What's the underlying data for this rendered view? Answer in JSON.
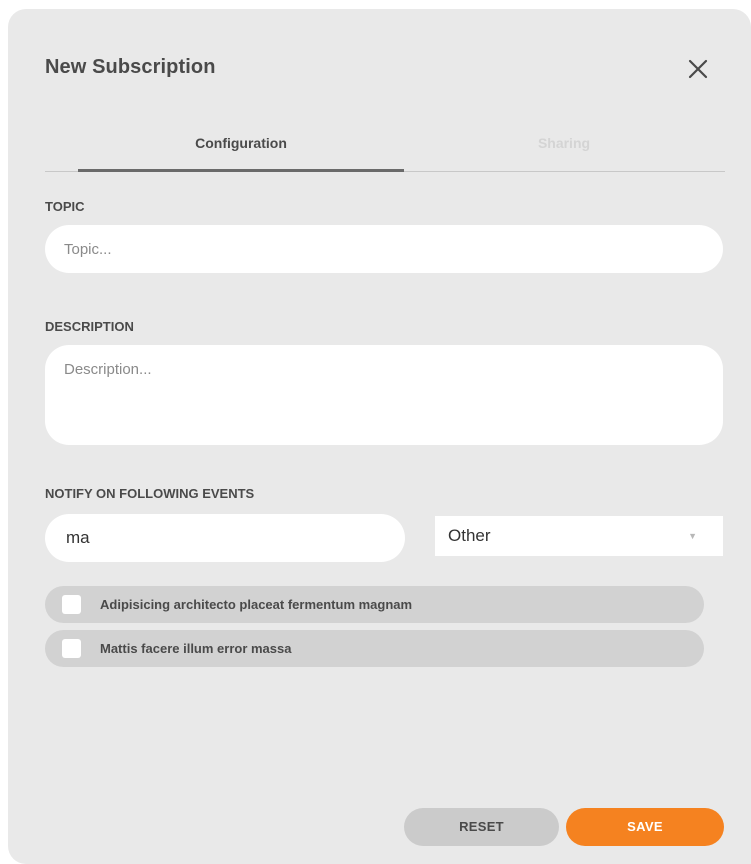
{
  "dialog": {
    "title": "New Subscription",
    "close_icon": "close-icon"
  },
  "tabs": [
    {
      "label": "Configuration",
      "active": true
    },
    {
      "label": "Sharing",
      "active": false
    }
  ],
  "form": {
    "topic": {
      "label": "TOPIC",
      "value": "",
      "placeholder": "Topic..."
    },
    "description": {
      "label": "DESCRIPTION",
      "value": "",
      "placeholder": "Description..."
    },
    "events": {
      "label": "NOTIFY ON FOLLOWING EVENTS",
      "search_value": "ma",
      "category_selected": "Other",
      "dropdown_icon": "caret-down-icon",
      "options": [
        {
          "label": "Adipisicing architecto placeat fermentum magnam",
          "checked": false
        },
        {
          "label": "Mattis facere illum error massa",
          "checked": false
        }
      ]
    }
  },
  "footer": {
    "reset_label": "RESET",
    "save_label": "SAVE"
  },
  "colors": {
    "accent": "#f58220",
    "modal_bg": "#e9e9e9",
    "option_bg": "#d2d2d2"
  }
}
